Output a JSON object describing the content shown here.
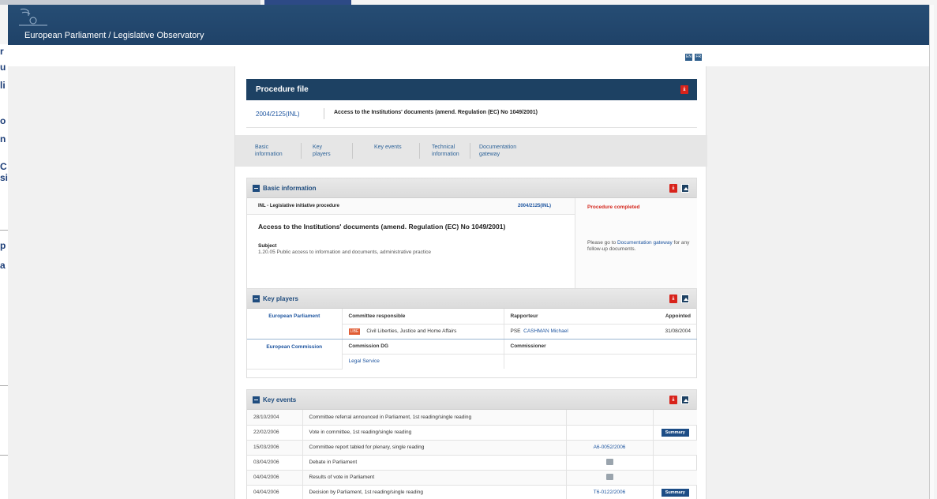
{
  "window": {
    "title": "European Parliament / Legislative Observatory"
  },
  "languages": [
    "EN",
    "FR"
  ],
  "procedure": {
    "header": "Procedure file",
    "code": "2004/2125(INL)",
    "title": "Access to the Institutions' documents (amend. Regulation (EC) No 1049/2001)"
  },
  "tabs": [
    {
      "label": "Basic information"
    },
    {
      "label": "Key players"
    },
    {
      "label": "Key events"
    },
    {
      "label": "Technical information"
    },
    {
      "label": "Documentation gateway"
    }
  ],
  "basic_info": {
    "heading": "Basic information",
    "type": "INL - Legislative initiative procedure",
    "code": "2004/2125(INL)",
    "status": "Procedure completed",
    "title": "Access to the Institutions' documents (amend. Regulation (EC) No 1049/2001)",
    "subject_label": "Subject",
    "subject_value": "1.20.05 Public access to information and documents, administrative practice",
    "note_prefix": "Please go to",
    "note_link": "Documentation gateway",
    "note_suffix": "for any follow-up documents."
  },
  "key_players": {
    "heading": "Key players",
    "ep": {
      "institution": "European Parliament",
      "committee_header": "Committee responsible",
      "rapporteur_header": "Rapporteur",
      "appointed_header": "Appointed",
      "committee_tag": "LIBE",
      "committee_name": "Civil Liberties, Justice and Home Affairs",
      "group": "PSE",
      "rapporteur": "CASHMAN Michael",
      "appointed": "31/08/2004"
    },
    "ec": {
      "institution": "European Commission",
      "dg_header": "Commission DG",
      "commissioner_header": "Commissioner",
      "dg": "Legal Service"
    }
  },
  "key_events": {
    "heading": "Key events",
    "summary_label": "Summary",
    "rows": [
      {
        "date": "28/10/2004",
        "event": "Committee referral announced in Parliament, 1st reading/single reading",
        "doc": "",
        "summary": false,
        "icon": ""
      },
      {
        "date": "22/02/2006",
        "event": "Vote in committee, 1st reading/single reading",
        "doc": "",
        "summary": true,
        "icon": ""
      },
      {
        "date": "15/03/2006",
        "event": "Committee report tabled for plenary, single reading",
        "doc": "A6-0052/2006",
        "summary": false,
        "icon": ""
      },
      {
        "date": "03/04/2006",
        "event": "Debate in Parliament",
        "doc": "",
        "summary": false,
        "icon": "debate-icon"
      },
      {
        "date": "04/04/2006",
        "event": "Results of vote in Parliament",
        "doc": "",
        "summary": false,
        "icon": "vote-results-icon"
      },
      {
        "date": "04/04/2006",
        "event": "Decision by Parliament, 1st reading/single reading",
        "doc": "T6-0122/2006",
        "summary": true,
        "icon": ""
      }
    ]
  },
  "colors": {
    "header": "#1f4268",
    "accent": "#1f56a0",
    "status": "#d4291f"
  }
}
